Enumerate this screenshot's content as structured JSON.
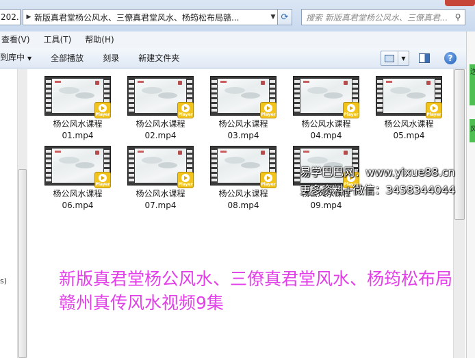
{
  "window": {
    "nav_fragment": "202...",
    "address_path": "新版真君堂杨公风水、三僚真君堂风水、杨筠松布局赣...",
    "search_placeholder": "搜索 新版真君堂杨公风水、三僚真君..."
  },
  "menu": [
    "查看(V)",
    "工具(T)",
    "帮助(H)"
  ],
  "toolbar": {
    "library_label": "到库中",
    "play_all_label": "全部播放",
    "burn_label": "刻录",
    "new_folder_label": "新建文件夹"
  },
  "nav": {
    "label": "s)"
  },
  "files": [
    {
      "line1": "杨公风水课程",
      "line2": "01.mp4"
    },
    {
      "line1": "杨公风水课程",
      "line2": "02.mp4"
    },
    {
      "line1": "杨公风水课程",
      "line2": "03.mp4"
    },
    {
      "line1": "杨公风水课程",
      "line2": "04.mp4"
    },
    {
      "line1": "杨公风水课程",
      "line2": "05.mp4"
    },
    {
      "line1": "杨公风水课程",
      "line2": "06.mp4"
    },
    {
      "line1": "杨公风水课程",
      "line2": "07.mp4"
    },
    {
      "line1": "杨公风水课程",
      "line2": "08.mp4"
    },
    {
      "line1": "杨公风水课程",
      "line2": "09.mp4"
    }
  ],
  "player_badge": "Player",
  "edge": {
    "t1": "送",
    "t2": "风"
  },
  "watermark": {
    "line1": "易学巴巴网：www.yixue88.cn",
    "line2": "更多资料+微信：3458344044"
  },
  "caption": "新版真君堂杨公风水、三僚真君堂风水、杨筠松布局赣州真传风水视频9集",
  "colors": {
    "caption": "#e23fe8",
    "player_badge": "#f2c31b",
    "close": "#c7463a"
  }
}
